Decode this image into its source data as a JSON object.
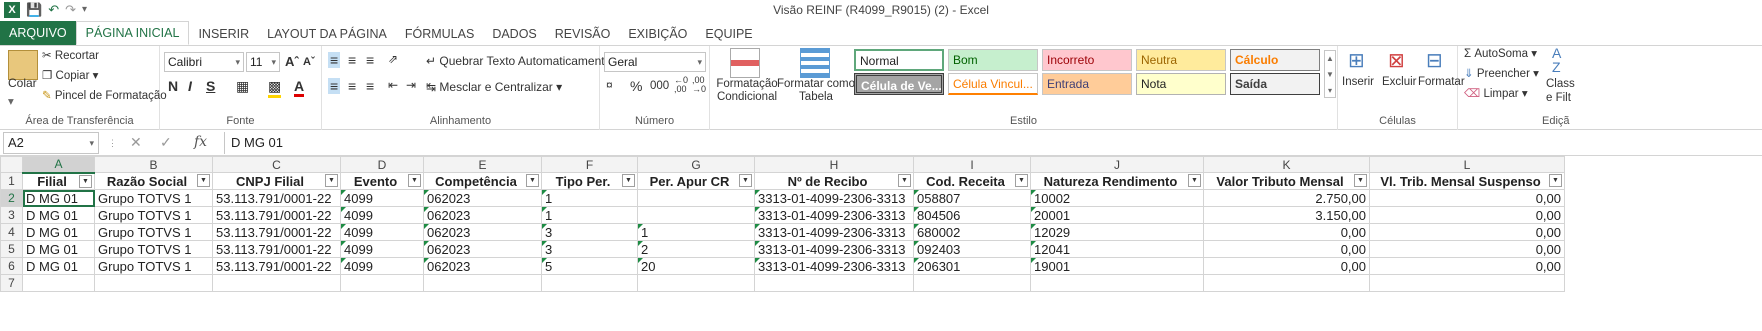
{
  "window": {
    "title": "Visão REINF (R4099_R9015) (2) - Excel"
  },
  "tabs": [
    "ARQUIVO",
    "PÁGINA INICIAL",
    "INSERIR",
    "LAYOUT DA PÁGINA",
    "FÓRMULAS",
    "DADOS",
    "REVISÃO",
    "EXIBIÇÃO",
    "EQUIPE"
  ],
  "ribbon": {
    "clipboard": {
      "paste": "Colar",
      "cut": "Recortar",
      "copy": "Copiar",
      "format_painter": "Pincel de Formatação",
      "label": "Área de Transferência"
    },
    "font": {
      "name": "Calibri",
      "size": "11",
      "label": "Fonte",
      "bold": "N",
      "italic": "I",
      "underline": "S"
    },
    "alignment": {
      "wrap": "Quebrar Texto Automaticamente",
      "merge": "Mesclar e Centralizar",
      "label": "Alinhamento"
    },
    "number": {
      "format": "Geral",
      "percent": "%",
      "thousands": "000",
      "label": "Número"
    },
    "styles": {
      "conditional": "Formatação Condicional",
      "format_table": "Formatar como Tabela",
      "cells": [
        "Normal",
        "Bom",
        "Incorreto",
        "Neutra",
        "Cálculo",
        "Célula de Ve...",
        "Célula Vincul...",
        "Entrada",
        "Nota",
        "Saída"
      ],
      "label": "Estilo"
    },
    "cells": {
      "insert": "Inserir",
      "delete": "Excluir",
      "format": "Formatar",
      "label": "Células"
    },
    "editing": {
      "autosum": "AutoSoma",
      "fill": "Preencher",
      "clear": "Limpar",
      "sort": "Class",
      "sort2": "e Filt",
      "label": "Ediçã"
    }
  },
  "formula_bar": {
    "name_box": "A2",
    "fx": "fx",
    "value": "D MG 01"
  },
  "sheet": {
    "columns": [
      "A",
      "B",
      "C",
      "D",
      "E",
      "F",
      "G",
      "H",
      "I",
      "J",
      "K",
      "L"
    ],
    "rows": [
      "1",
      "2",
      "3",
      "4",
      "5",
      "6",
      "7"
    ],
    "headers": [
      "Filial",
      "Razão Social",
      "CNPJ Filial",
      "Evento",
      "Competência",
      "Tipo Per.",
      "Per. Apur CR",
      "Nº de Recibo",
      "Cod. Receita",
      "Natureza Rendimento",
      "Valor Tributo Mensal",
      "Vl. Trib. Mensal Suspenso"
    ],
    "data": [
      [
        "D MG 01",
        "Grupo TOTVS 1",
        "53.113.791/0001-22",
        "4099",
        "062023",
        "1",
        "",
        "3313-01-4099-2306-3313",
        "058807",
        "10002",
        "2.750,00",
        "0,00"
      ],
      [
        "D MG 01",
        "Grupo TOTVS 1",
        "53.113.791/0001-22",
        "4099",
        "062023",
        "1",
        "",
        "3313-01-4099-2306-3313",
        "804506",
        "20001",
        "3.150,00",
        "0,00"
      ],
      [
        "D MG 01",
        "Grupo TOTVS 1",
        "53.113.791/0001-22",
        "4099",
        "062023",
        "3",
        "1",
        "3313-01-4099-2306-3313",
        "680002",
        "12029",
        "0,00",
        "0,00"
      ],
      [
        "D MG 01",
        "Grupo TOTVS 1",
        "53.113.791/0001-22",
        "4099",
        "062023",
        "3",
        "2",
        "3313-01-4099-2306-3313",
        "092403",
        "12041",
        "0,00",
        "0,00"
      ],
      [
        "D MG 01",
        "Grupo TOTVS 1",
        "53.113.791/0001-22",
        "4099",
        "062023",
        "5",
        "20",
        "3313-01-4099-2306-3313",
        "206301",
        "19001",
        "0,00",
        "0,00"
      ]
    ]
  }
}
